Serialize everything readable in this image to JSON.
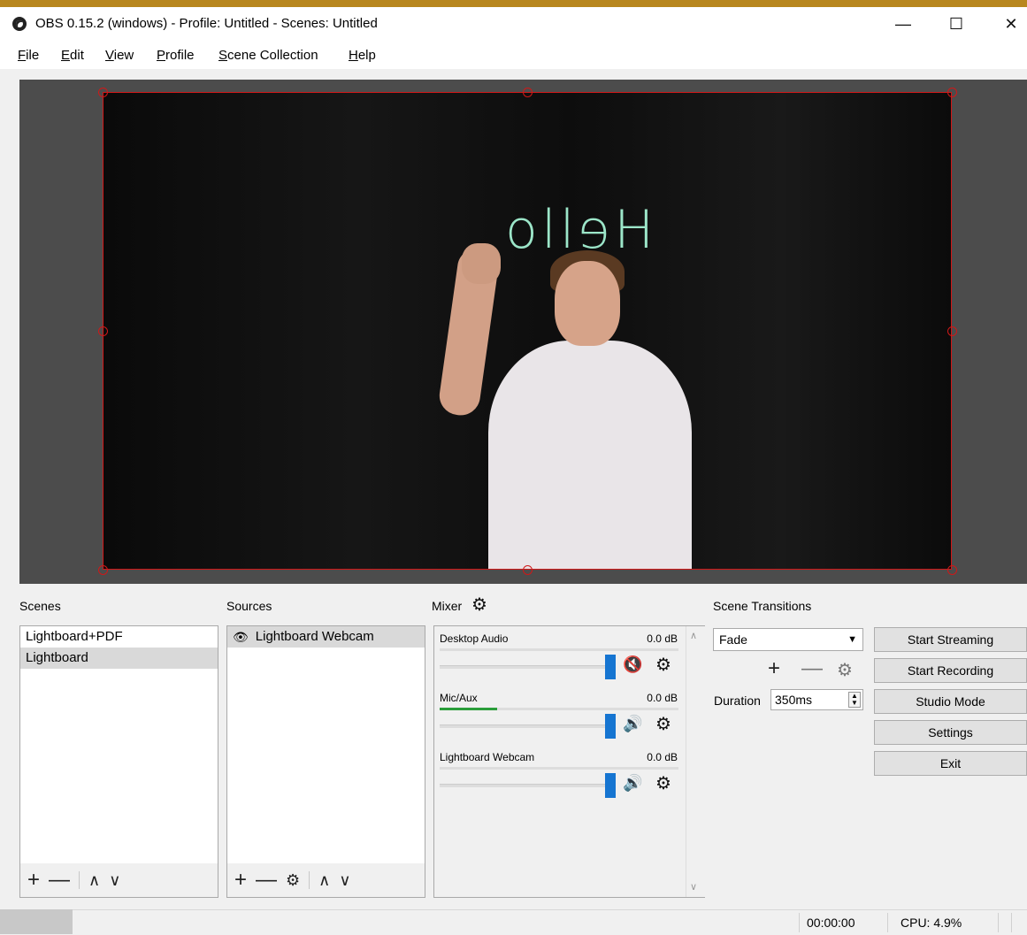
{
  "window": {
    "title": "OBS 0.15.2 (windows) - Profile: Untitled - Scenes: Untitled",
    "minimize": "—",
    "maximize": "☐",
    "close": "✕"
  },
  "menu": [
    {
      "mnemonic": "F",
      "rest": "ile"
    },
    {
      "mnemonic": "E",
      "rest": "dit"
    },
    {
      "mnemonic": "V",
      "rest": "iew"
    },
    {
      "mnemonic": "P",
      "rest": "rofile"
    },
    {
      "mnemonic": "S",
      "rest": "cene Collection"
    },
    {
      "mnemonic": "H",
      "rest": "elp"
    }
  ],
  "preview": {
    "board_text": "Hello"
  },
  "scenes": {
    "label": "Scenes",
    "items": [
      "Lightboard+PDF",
      "Lightboard"
    ],
    "selected_index": 1,
    "toolbar": [
      "+",
      "—",
      "∧",
      "∨"
    ]
  },
  "sources": {
    "label": "Sources",
    "items": [
      "Lightboard Webcam"
    ],
    "toolbar": [
      "+",
      "—",
      "⚙",
      "∧",
      "∨"
    ]
  },
  "mixer": {
    "label": "Mixer",
    "channels": [
      {
        "name": "Desktop Audio",
        "db": "0.0 dB",
        "level": 0.0,
        "muted": true
      },
      {
        "name": "Mic/Aux",
        "db": "0.0 dB",
        "level": 0.24,
        "muted": false
      },
      {
        "name": "Lightboard Webcam",
        "db": "0.0 dB",
        "level": 0.0,
        "muted": false
      }
    ]
  },
  "transitions": {
    "label": "Scene Transitions",
    "selected": "Fade",
    "duration_label": "Duration",
    "duration_value": "350ms"
  },
  "controls": [
    "Start Streaming",
    "Start Recording",
    "Studio Mode",
    "Settings",
    "Exit"
  ],
  "status": {
    "time": "00:00:00",
    "cpu": "CPU: 4.9%"
  },
  "colors": {
    "selection_border": "#d01818",
    "slider_knob": "#1675d1",
    "meter_fill": "#2a9d3a",
    "mute_red": "#cc1a1a"
  }
}
